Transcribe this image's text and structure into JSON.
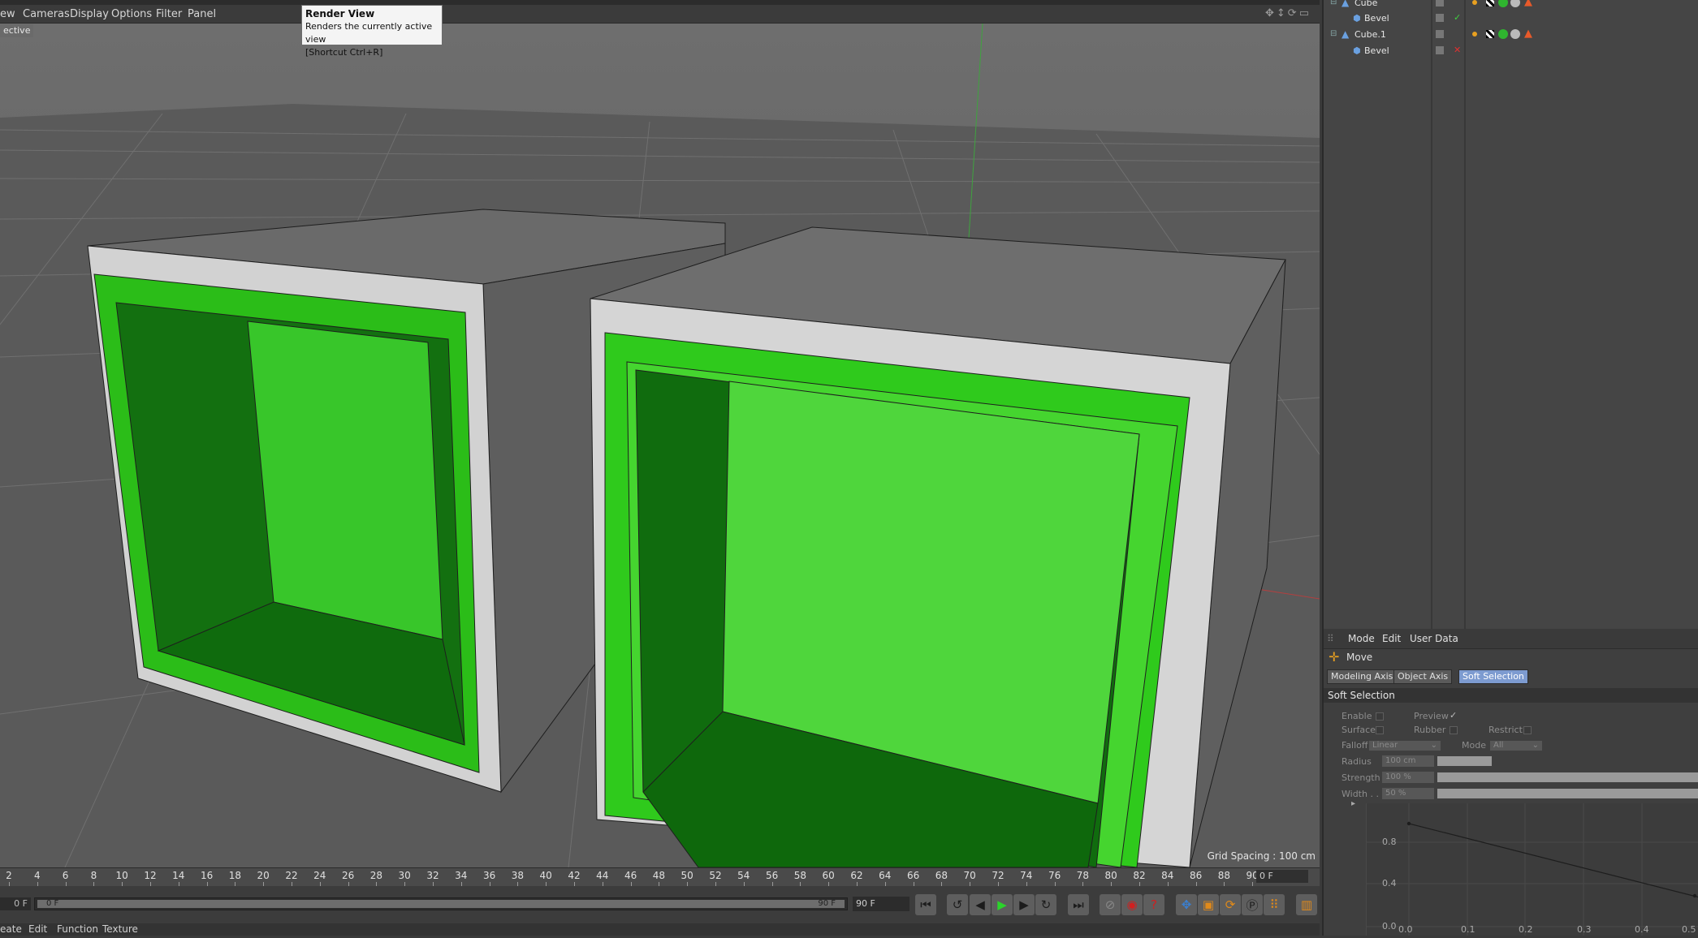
{
  "menu": {
    "view": "ew",
    "cameras": "Cameras",
    "display": "Display",
    "options": "Options",
    "filter": "Filter",
    "panel": "Panel"
  },
  "viewport": {
    "label": "ective",
    "grid_spacing": "Grid Spacing : 100 cm",
    "background": "#5b5b5b",
    "face_green": "#33c21e",
    "bevel_green": "#4fd93a"
  },
  "tooltip": {
    "title": "Render View",
    "line1": "Renders the currently active view",
    "line2": "[Shortcut Ctrl+R]"
  },
  "timeline": {
    "ticks": [
      "2",
      "4",
      "6",
      "8",
      "10",
      "12",
      "14",
      "16",
      "18",
      "20",
      "22",
      "24",
      "26",
      "28",
      "30",
      "32",
      "34",
      "36",
      "38",
      "40",
      "42",
      "44",
      "46",
      "48",
      "50",
      "52",
      "54",
      "56",
      "58",
      "60",
      "62",
      "64",
      "66",
      "68",
      "70",
      "72",
      "74",
      "76",
      "78",
      "80",
      "82",
      "84",
      "86",
      "88",
      "90"
    ],
    "current_frame": "0 F",
    "start_frame": "0 F",
    "range_left": "0 F",
    "range_right": "90 F",
    "end_frame": "90 F"
  },
  "bottom_menu": {
    "create": "eate",
    "edit": "Edit",
    "function": "Function",
    "texture": "Texture"
  },
  "objects": [
    {
      "name": "Cube",
      "type": "parent"
    },
    {
      "name": "Bevel",
      "type": "child",
      "status": "✓"
    },
    {
      "name": "Cube.1",
      "type": "parent"
    },
    {
      "name": "Bevel",
      "type": "child",
      "status": "✕"
    }
  ],
  "attributes": {
    "menu": {
      "mode": "Mode",
      "edit": "Edit",
      "user_data": "User Data"
    },
    "tool": "Move",
    "tabs": [
      "Modeling Axis",
      "Object Axis",
      "Soft Selection"
    ],
    "active_tab": "Soft Selection",
    "section": "Soft Selection",
    "enable": "Enable",
    "preview": "Preview",
    "preview_check": "✓",
    "surface": "Surface",
    "rubber": "Rubber",
    "restrict": "Restrict",
    "falloff": "Falloff",
    "falloff_value": "Linear",
    "mode": "Mode",
    "mode_value": "All",
    "radius": "Radius",
    "radius_value": "100 cm",
    "strength": "Strength",
    "strength_value": "100 %",
    "width": "Width . .",
    "width_value": "50 %",
    "graph_y": [
      "0.8",
      "0.4",
      "0.0"
    ],
    "graph_x": [
      "0.0",
      "0.1",
      "0.2",
      "0.3",
      "0.4",
      "0.5"
    ]
  }
}
